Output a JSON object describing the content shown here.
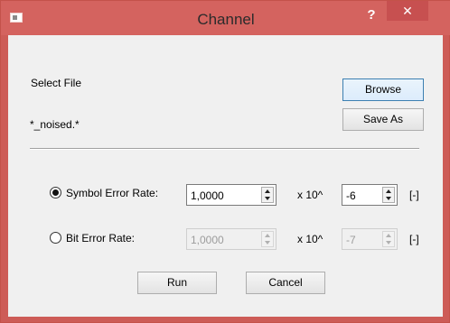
{
  "window": {
    "title": "Channel",
    "help_glyph": "?",
    "close_glyph": "✕"
  },
  "file": {
    "select_label": "Select File",
    "pattern": "*_noised.*",
    "browse_label": "Browse",
    "save_as_label": "Save As"
  },
  "symbol_rate": {
    "label": "Symbol Error Rate:",
    "selected": true,
    "mantissa": "1,0000",
    "times_label": "x 10^",
    "exponent": "-6",
    "unit": "[-]"
  },
  "bit_rate": {
    "label": "Bit Error Rate:",
    "selected": false,
    "mantissa": "1,0000",
    "times_label": "x 10^",
    "exponent": "-7",
    "unit": "[-]"
  },
  "actions": {
    "run_label": "Run",
    "cancel_label": "Cancel"
  },
  "colors": {
    "titlebar": "#d4635f",
    "close_button": "#c75050",
    "client_bg": "#f0f0f0"
  }
}
